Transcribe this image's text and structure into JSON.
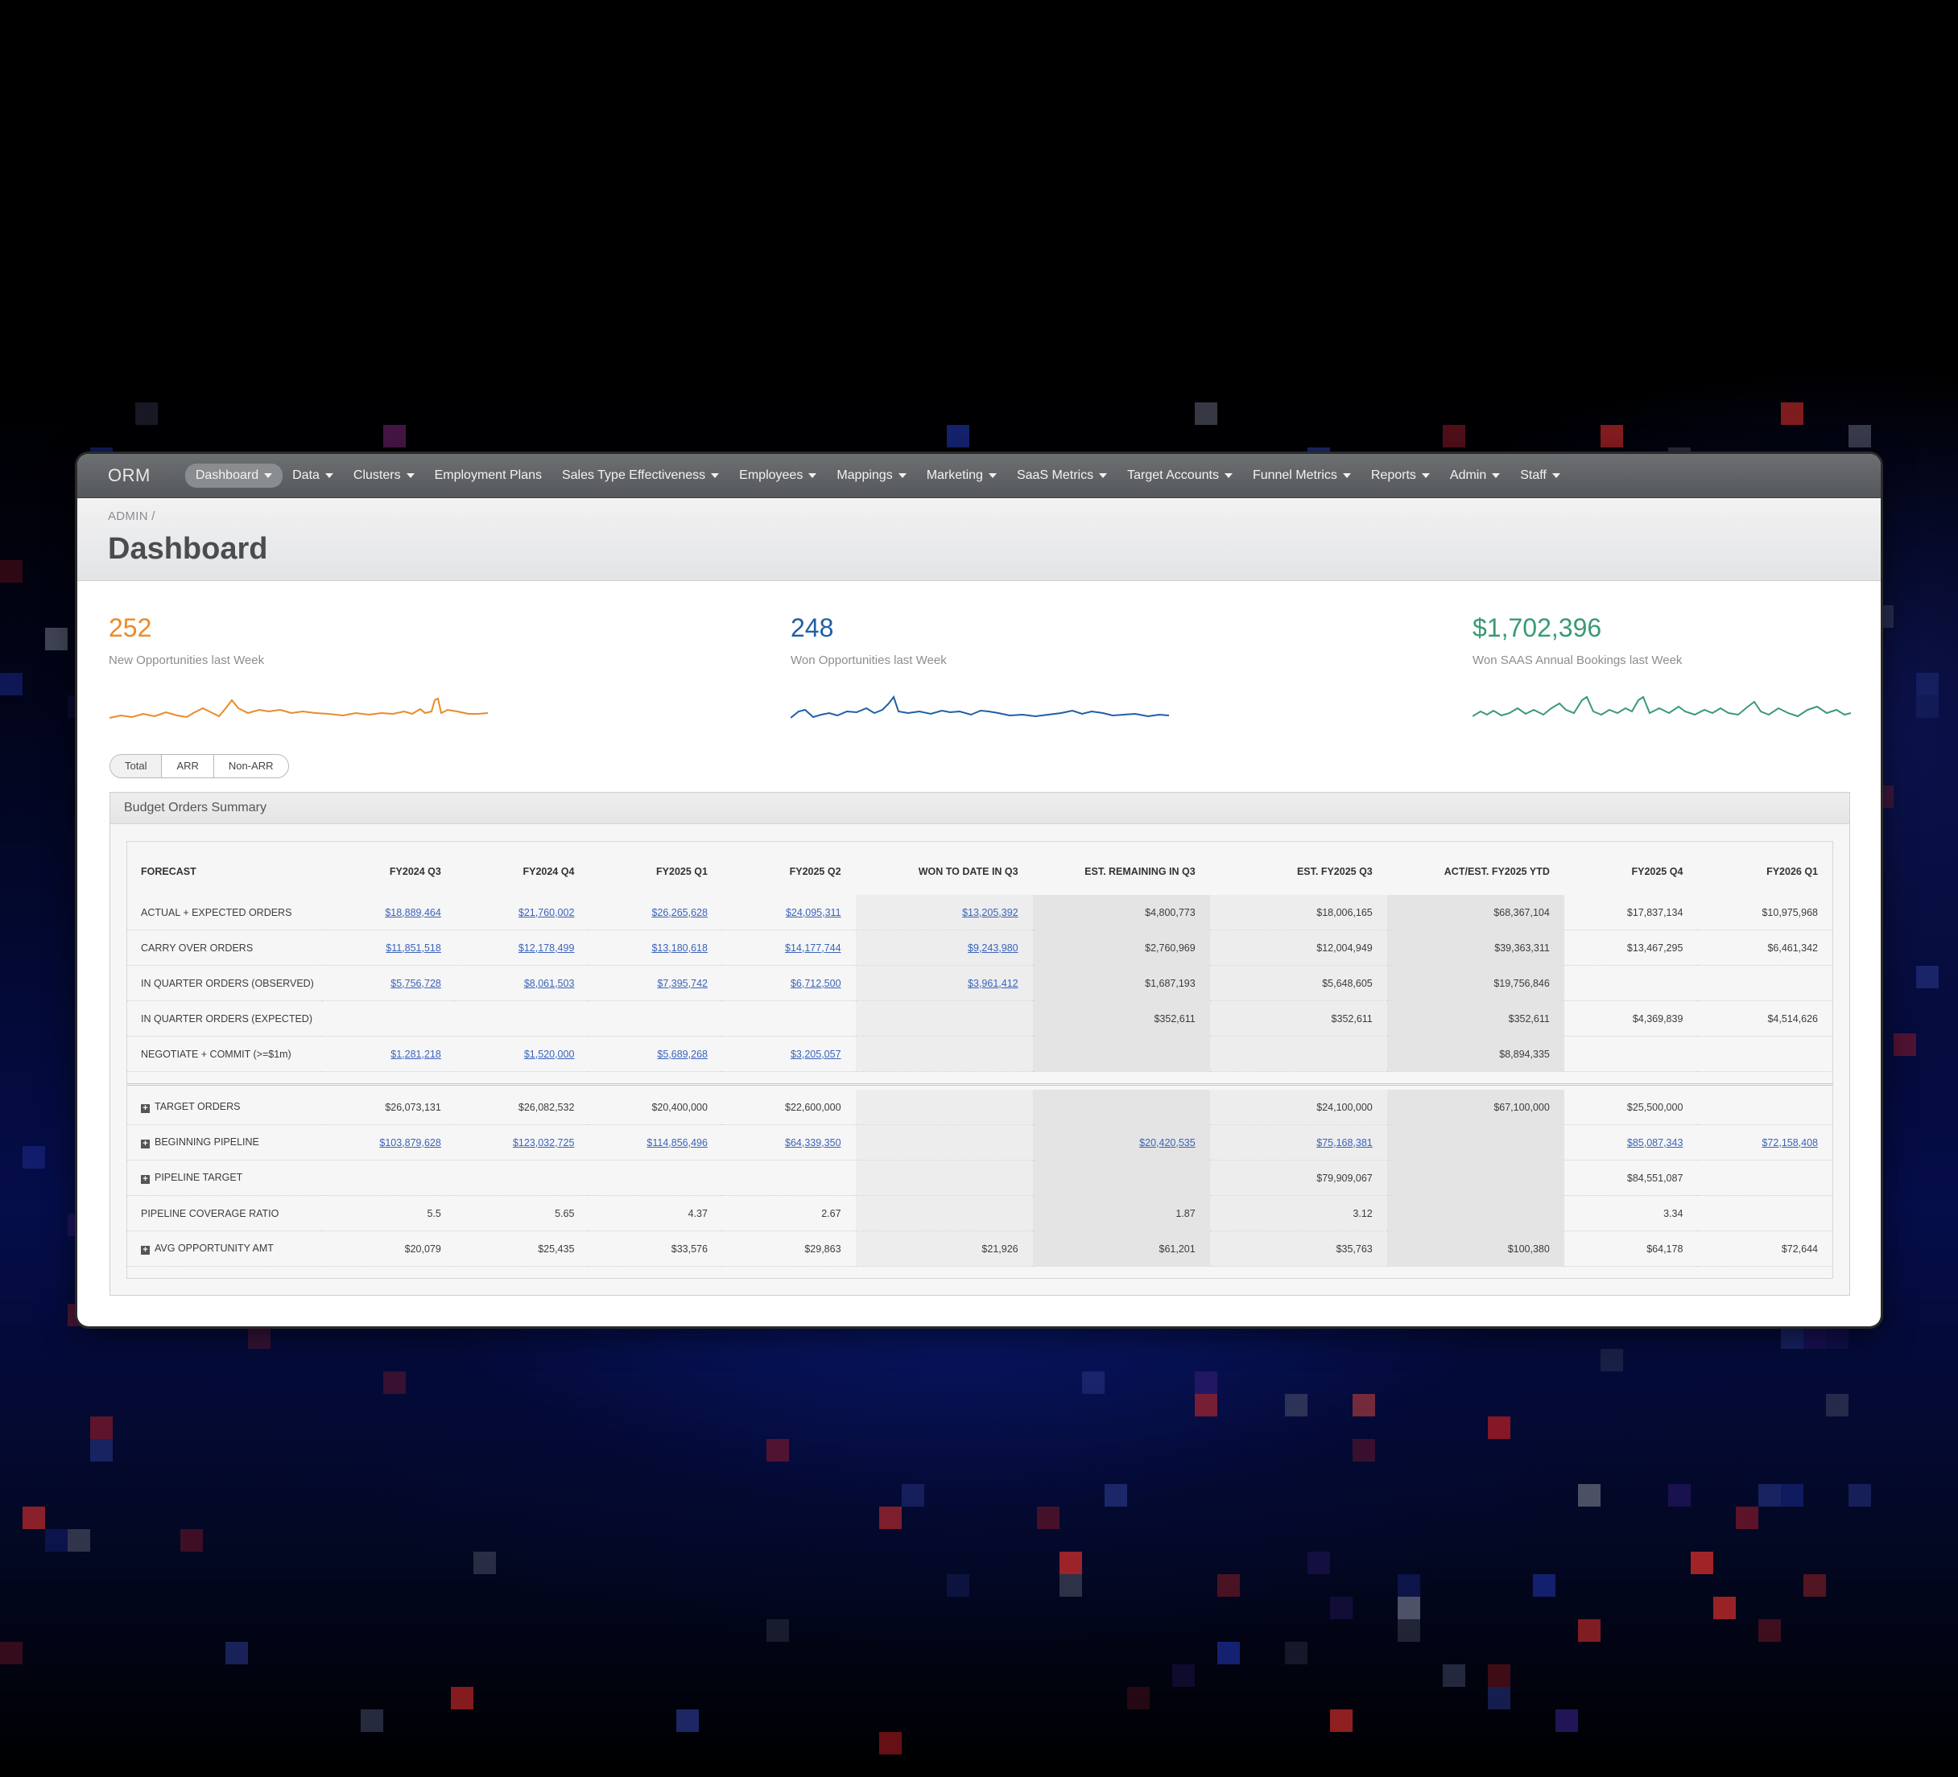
{
  "app": {
    "brand": "ORM"
  },
  "nav": [
    {
      "label": "Dashboard",
      "active": true,
      "dropdown": true
    },
    {
      "label": "Data",
      "dropdown": true
    },
    {
      "label": "Clusters",
      "dropdown": true
    },
    {
      "label": "Employment Plans",
      "dropdown": false
    },
    {
      "label": "Sales Type Effectiveness",
      "dropdown": true
    },
    {
      "label": "Employees",
      "dropdown": true
    },
    {
      "label": "Mappings",
      "dropdown": true
    },
    {
      "label": "Marketing",
      "dropdown": true
    },
    {
      "label": "SaaS Metrics",
      "dropdown": true
    },
    {
      "label": "Target Accounts",
      "dropdown": true
    },
    {
      "label": "Funnel Metrics",
      "dropdown": true
    },
    {
      "label": "Reports",
      "dropdown": true
    },
    {
      "label": "Admin",
      "dropdown": true
    },
    {
      "label": "Staff",
      "dropdown": true
    }
  ],
  "header": {
    "breadcrumb": "ADMIN /",
    "title": "Dashboard"
  },
  "kpis": [
    {
      "value": "252",
      "label": "New Opportunities last Week",
      "color": "#e98b2a"
    },
    {
      "value": "248",
      "label": "Won Opportunities last Week",
      "color": "#1f5fa6"
    },
    {
      "value": "$1,702,396",
      "label": "Won SAAS Annual Bookings last Week",
      "color": "#3a9a72"
    }
  ],
  "toggles": [
    "Total",
    "ARR",
    "Non-ARR"
  ],
  "summary": {
    "title": "Budget Orders Summary",
    "columns": [
      "FORECAST",
      "FY2024 Q3",
      "FY2024 Q4",
      "FY2025 Q1",
      "FY2025 Q2",
      "WON TO DATE IN Q3",
      "EST. REMAINING IN Q3",
      "EST. FY2025 Q3",
      "ACT/EST. FY2025 YTD",
      "FY2025 Q4",
      "FY2026 Q1"
    ],
    "rows": [
      {
        "label": "ACTUAL + EXPECTED ORDERS",
        "cells": [
          "$18,889,464",
          "$21,760,002",
          "$26,265,628",
          "$24,095,311",
          "$13,205,392",
          "$4,800,773",
          "$18,006,165",
          "$68,367,104",
          "$17,837,134",
          "$10,975,968"
        ],
        "links": [
          1,
          1,
          1,
          1,
          1,
          0,
          0,
          0,
          0,
          0
        ]
      },
      {
        "label": "CARRY OVER ORDERS",
        "cells": [
          "$11,851,518",
          "$12,178,499",
          "$13,180,618",
          "$14,177,744",
          "$9,243,980",
          "$2,760,969",
          "$12,004,949",
          "$39,363,311",
          "$13,467,295",
          "$6,461,342"
        ],
        "links": [
          1,
          1,
          1,
          1,
          1,
          0,
          0,
          0,
          0,
          0
        ]
      },
      {
        "label": "IN QUARTER ORDERS (OBSERVED)",
        "cells": [
          "$5,756,728",
          "$8,061,503",
          "$7,395,742",
          "$6,712,500",
          "$3,961,412",
          "$1,687,193",
          "$5,648,605",
          "$19,756,846",
          "",
          ""
        ],
        "links": [
          1,
          1,
          1,
          1,
          1,
          0,
          0,
          0,
          0,
          0
        ]
      },
      {
        "label": "IN QUARTER ORDERS (EXPECTED)",
        "cells": [
          "",
          "",
          "",
          "",
          "",
          "$352,611",
          "$352,611",
          "$352,611",
          "$4,369,839",
          "$4,514,626"
        ],
        "links": [
          0,
          0,
          0,
          0,
          0,
          0,
          0,
          0,
          0,
          0
        ]
      },
      {
        "label": "NEGOTIATE + COMMIT (>=$1m)",
        "cells": [
          "$1,281,218",
          "$1,520,000",
          "$5,689,268",
          "$3,205,057",
          "",
          "",
          "",
          "$8,894,335",
          "",
          ""
        ],
        "links": [
          1,
          1,
          1,
          1,
          0,
          0,
          0,
          0,
          0,
          0
        ]
      }
    ],
    "rows2": [
      {
        "label": "TARGET ORDERS",
        "expand": true,
        "cells": [
          "$26,073,131",
          "$26,082,532",
          "$20,400,000",
          "$22,600,000",
          "",
          "",
          "$24,100,000",
          "$67,100,000",
          "$25,500,000",
          ""
        ],
        "links": [
          0,
          0,
          0,
          0,
          0,
          0,
          0,
          0,
          0,
          0
        ]
      },
      {
        "label": "BEGINNING PIPELINE",
        "expand": true,
        "cells": [
          "$103,879,628",
          "$123,032,725",
          "$114,856,496",
          "$64,339,350",
          "",
          "$20,420,535",
          "$75,168,381",
          "",
          "$85,087,343",
          "$72,158,408"
        ],
        "links": [
          1,
          1,
          1,
          1,
          0,
          1,
          1,
          0,
          1,
          1
        ]
      },
      {
        "label": "PIPELINE TARGET",
        "expand": true,
        "cells": [
          "",
          "",
          "",
          "",
          "",
          "",
          "$79,909,067",
          "",
          "$84,551,087",
          ""
        ],
        "links": [
          0,
          0,
          0,
          0,
          0,
          0,
          0,
          0,
          0,
          0
        ]
      },
      {
        "label": "PIPELINE COVERAGE RATIO",
        "expand": false,
        "cells": [
          "5.5",
          "5.65",
          "4.37",
          "2.67",
          "",
          "1.87",
          "3.12",
          "",
          "3.34",
          ""
        ],
        "links": [
          0,
          0,
          0,
          0,
          0,
          0,
          0,
          0,
          0,
          0
        ]
      },
      {
        "label": "AVG OPPORTUNITY AMT",
        "expand": true,
        "cells": [
          "$20,079",
          "$25,435",
          "$33,576",
          "$29,863",
          "$21,926",
          "$61,201",
          "$35,763",
          "$100,380",
          "$64,178",
          "$72,644"
        ],
        "links": [
          0,
          0,
          0,
          0,
          0,
          0,
          0,
          0,
          0,
          0
        ]
      }
    ]
  }
}
